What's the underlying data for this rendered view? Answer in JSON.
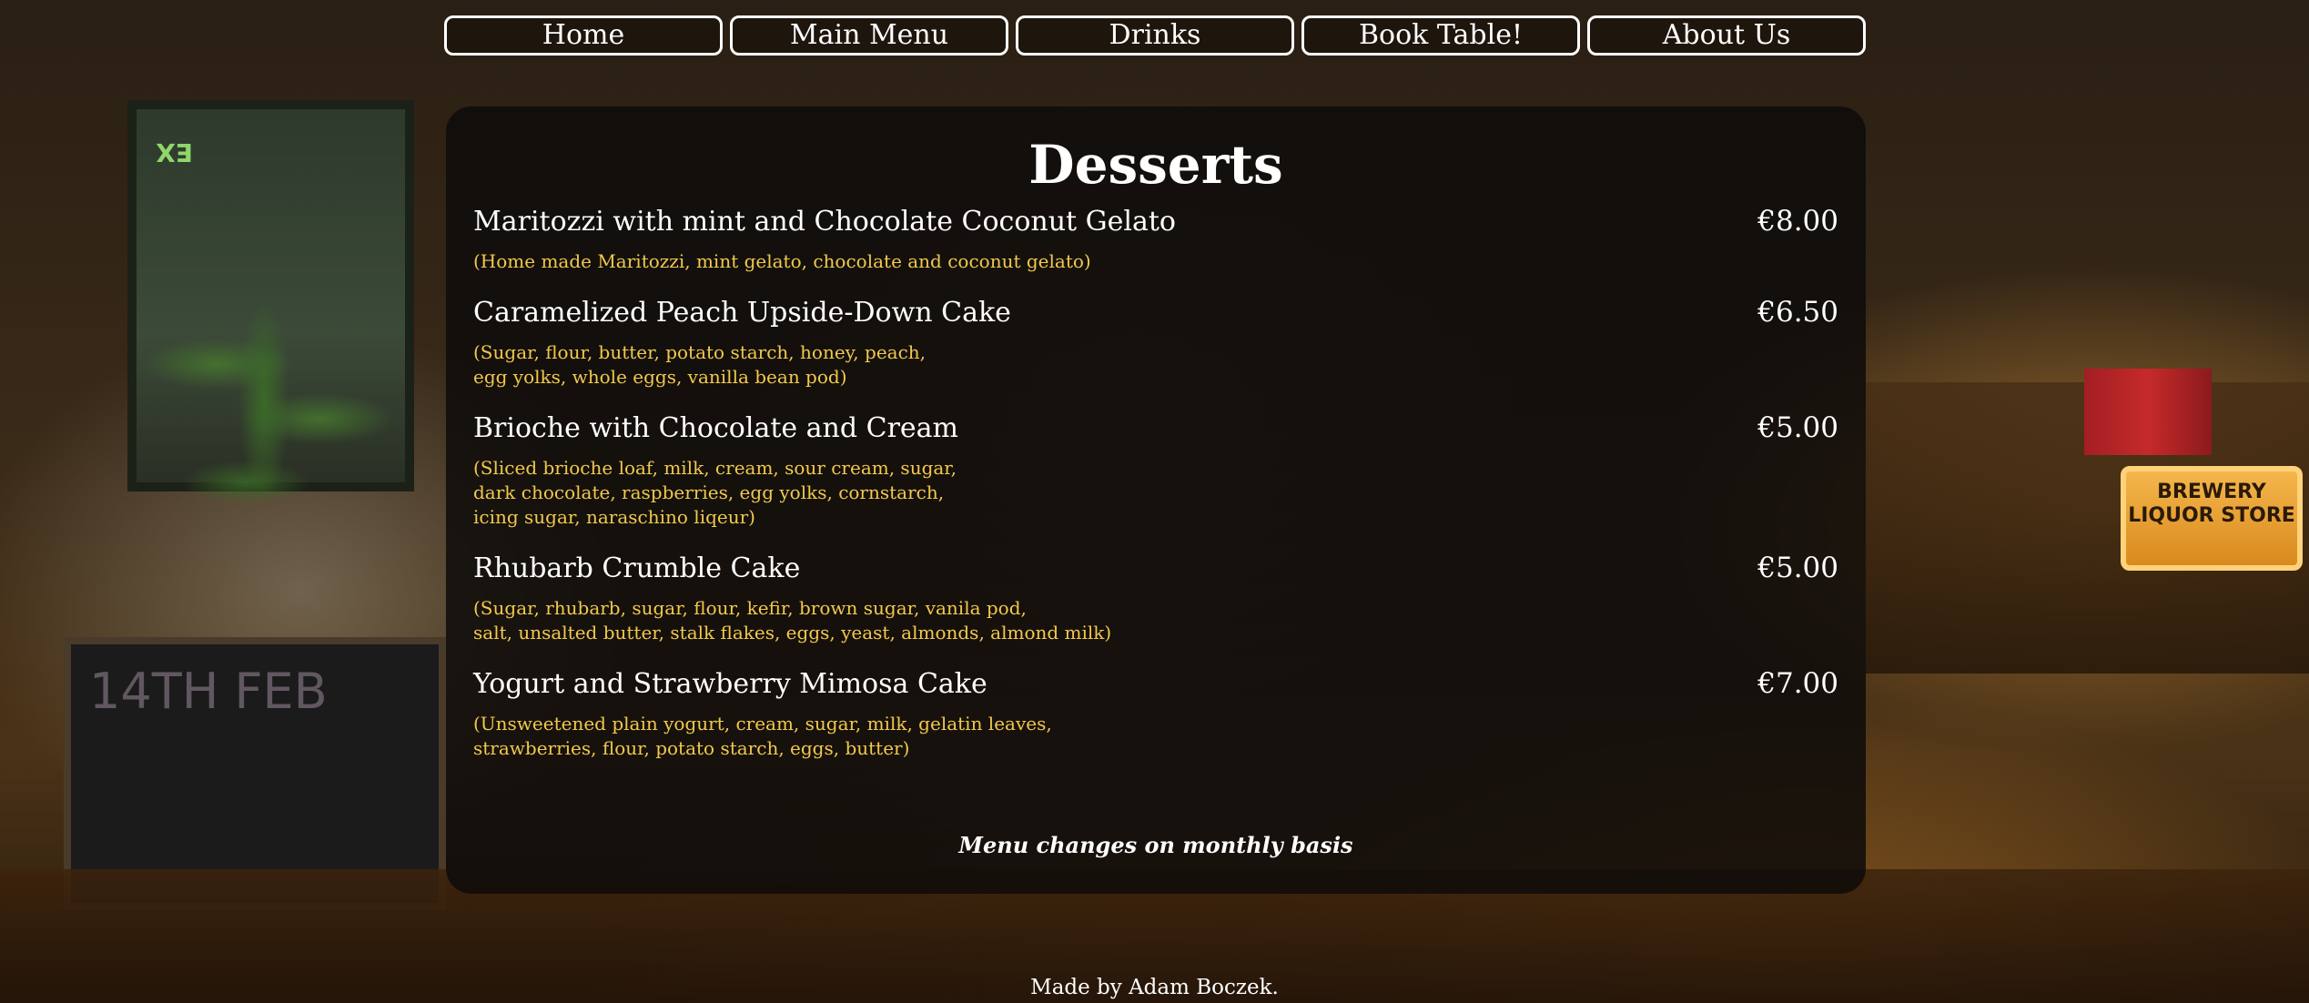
{
  "nav": {
    "items": [
      {
        "label": "Home"
      },
      {
        "label": "Main Menu"
      },
      {
        "label": "Drinks"
      },
      {
        "label": "Book Table!"
      },
      {
        "label": "About Us"
      }
    ]
  },
  "background": {
    "exit_sign": "EX",
    "chalkboard_text": "14TH FEB",
    "store_sign": "BREWERY LIQUOR STORE"
  },
  "menu": {
    "title": "Desserts",
    "items": [
      {
        "name": "Maritozzi with mint and Chocolate Coconut Gelato",
        "price": "€8.00",
        "description": "(Home made Maritozzi, mint gelato, chocolate and coconut gelato)"
      },
      {
        "name": "Caramelized Peach Upside-Down Cake",
        "price": "€6.50",
        "description": "(Sugar, flour, butter, potato starch, honey, peach,\negg yolks, whole eggs, vanilla bean pod)"
      },
      {
        "name": "Brioche with Chocolate and Cream",
        "price": "€5.00",
        "description": "(Sliced brioche loaf, milk, cream, sour cream, sugar,\ndark chocolate, raspberries, egg yolks, cornstarch,\nicing sugar, naraschino liqeur)"
      },
      {
        "name": "Rhubarb Crumble Cake",
        "price": "€5.00",
        "description": "(Sugar, rhubarb, sugar, flour, kefir, brown sugar, vanila pod,\nsalt, unsalted butter, stalk flakes, eggs, yeast, almonds, almond milk)"
      },
      {
        "name": "Yogurt and Strawberry Mimosa Cake",
        "price": "€7.00",
        "description": "(Unsweetened plain yogurt, cream, sugar, milk, gelatin leaves,\nstrawberries, flour, potato starch, eggs, butter)"
      }
    ],
    "note": "Menu changes on monthly basis"
  },
  "footer": {
    "text": "Made by Adam Boczek."
  },
  "colors": {
    "description": "#f2c94c",
    "panel": "#0e0c0a",
    "text": "#ffffff"
  }
}
